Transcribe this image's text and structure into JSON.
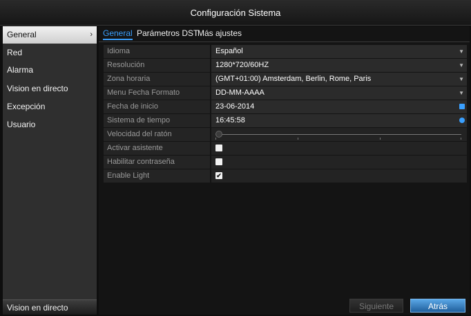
{
  "window": {
    "title": "Configuración Sistema"
  },
  "sidebar": {
    "items": [
      {
        "label": "General",
        "active": true
      },
      {
        "label": "Red"
      },
      {
        "label": "Alarma"
      },
      {
        "label": "Vision en directo"
      },
      {
        "label": "Excepción"
      },
      {
        "label": "Usuario"
      }
    ],
    "bottom_label": "Vision en directo"
  },
  "tabs": [
    {
      "label": "General",
      "active": true
    },
    {
      "label": "Parámetros DST"
    },
    {
      "label": "Más ajustes"
    }
  ],
  "settings": {
    "idioma": {
      "label": "Idioma",
      "value": "Español"
    },
    "resolucion": {
      "label": "Resolución",
      "value": "1280*720/60HZ"
    },
    "zona": {
      "label": "Zona horaria",
      "value": "(GMT+01:00) Amsterdam, Berlin, Rome, Paris"
    },
    "formato": {
      "label": "Menu Fecha Formato",
      "value": "DD-MM-AAAA"
    },
    "fecha": {
      "label": "Fecha de inicio",
      "value": "23-06-2014"
    },
    "tiempo": {
      "label": "Sistema de tiempo",
      "value": "16:45:58"
    },
    "raton": {
      "label": "Velocidad del ratón",
      "level": 0
    },
    "asistente": {
      "label": "Activar asistente",
      "checked": false
    },
    "contrasena": {
      "label": "Habilitar contraseña",
      "checked": false
    },
    "light": {
      "label": "Enable Light",
      "checked": true
    }
  },
  "buttons": {
    "next": "Siguiente",
    "back": "Atrás"
  },
  "icons": {
    "dropdown": "chevron-down-icon",
    "calendar": "calendar-icon",
    "clock": "clock-icon",
    "sidebar_arrow": "chevron-right-icon"
  },
  "colors": {
    "accent": "#3aa0ff",
    "background": "#0e0e0e"
  }
}
